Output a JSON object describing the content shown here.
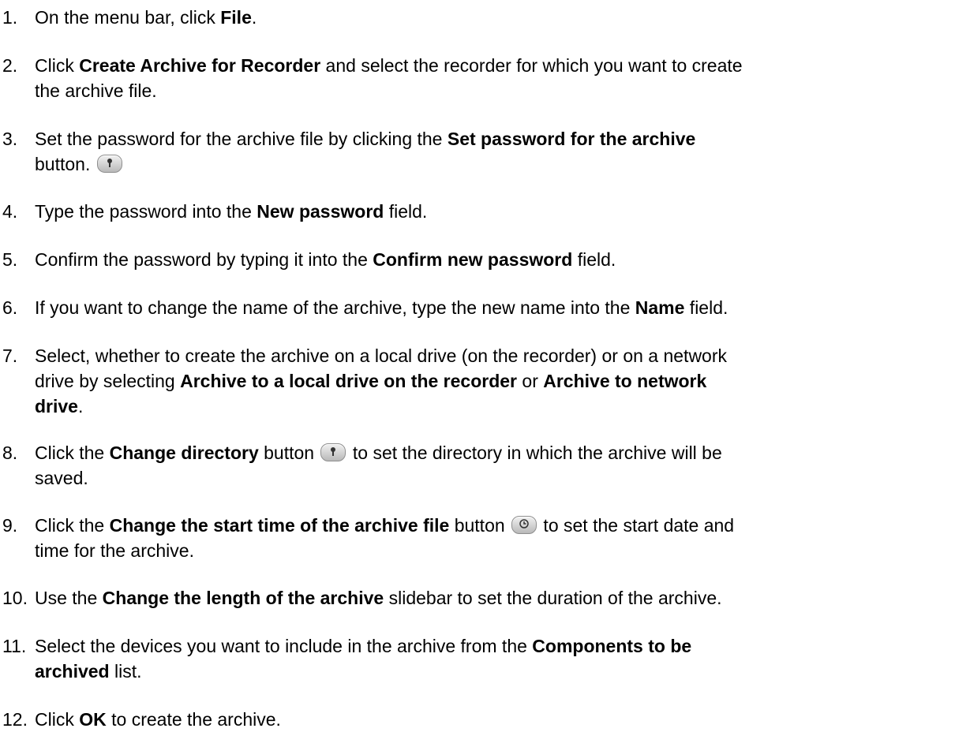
{
  "steps": [
    {
      "number": "1.",
      "parts": [
        {
          "t": "On the menu bar, click "
        },
        {
          "t": "File",
          "b": true
        },
        {
          "t": "."
        }
      ]
    },
    {
      "number": "2.",
      "parts": [
        {
          "t": "Click "
        },
        {
          "t": "Create Archive for Recorder",
          "b": true
        },
        {
          "t": " and select the recorder for which you want to create"
        },
        {
          "br": true
        },
        {
          "t": "the archive file."
        }
      ]
    },
    {
      "number": "3.",
      "parts": [
        {
          "t": "Set the password for the archive file by clicking the "
        },
        {
          "t": "Set password for the archive",
          "b": true
        },
        {
          "br": true
        },
        {
          "t": "button. "
        },
        {
          "icon": "password-button-icon"
        }
      ]
    },
    {
      "number": "4.",
      "parts": [
        {
          "t": "Type the password into the "
        },
        {
          "t": "New password",
          "b": true
        },
        {
          "t": " field."
        }
      ]
    },
    {
      "number": "5.",
      "parts": [
        {
          "t": "Confirm the password by typing it into the "
        },
        {
          "t": "Confirm new password",
          "b": true
        },
        {
          "t": " field."
        }
      ]
    },
    {
      "number": "6.",
      "parts": [
        {
          "t": "If you want to change the name of the archive, type the new name into the "
        },
        {
          "t": "Name",
          "b": true
        },
        {
          "t": " field."
        }
      ]
    },
    {
      "number": "7.",
      "parts": [
        {
          "t": "Select, whether to create the archive on a local drive (on the recorder) or on a network"
        },
        {
          "br": true
        },
        {
          "t": "drive by selecting "
        },
        {
          "t": "Archive to a local drive on the recorder",
          "b": true
        },
        {
          "t": " or "
        },
        {
          "t": "Archive to network",
          "b": true
        },
        {
          "br": true
        },
        {
          "t": "drive",
          "b": true
        },
        {
          "t": "."
        }
      ]
    },
    {
      "number": "8.",
      "parts": [
        {
          "t": "Click the "
        },
        {
          "t": "Change directory",
          "b": true
        },
        {
          "t": " button "
        },
        {
          "icon": "change-directory-button-icon"
        },
        {
          "t": " to set the directory in which the archive will be"
        },
        {
          "br": true
        },
        {
          "t": "saved."
        }
      ]
    },
    {
      "number": "9.",
      "parts": [
        {
          "t": "Click the "
        },
        {
          "t": "Change the start time of the archive file",
          "b": true
        },
        {
          "t": " button "
        },
        {
          "icon": "clock-button-icon"
        },
        {
          "t": " to set the start date and"
        },
        {
          "br": true
        },
        {
          "t": "time for the archive."
        }
      ]
    },
    {
      "number": "10.",
      "parts": [
        {
          "t": "Use the "
        },
        {
          "t": "Change the length of the archive",
          "b": true
        },
        {
          "t": " slidebar to set the duration of the archive."
        }
      ]
    },
    {
      "number": "11.",
      "parts": [
        {
          "t": "Select the devices you want to include in the archive from the "
        },
        {
          "t": "Components to be",
          "b": true
        },
        {
          "br": true
        },
        {
          "t": "archived",
          "b": true
        },
        {
          "t": " list."
        }
      ]
    },
    {
      "number": "12.",
      "parts": [
        {
          "t": "Click "
        },
        {
          "t": "OK",
          "b": true
        },
        {
          "t": " to create the archive."
        }
      ]
    }
  ]
}
